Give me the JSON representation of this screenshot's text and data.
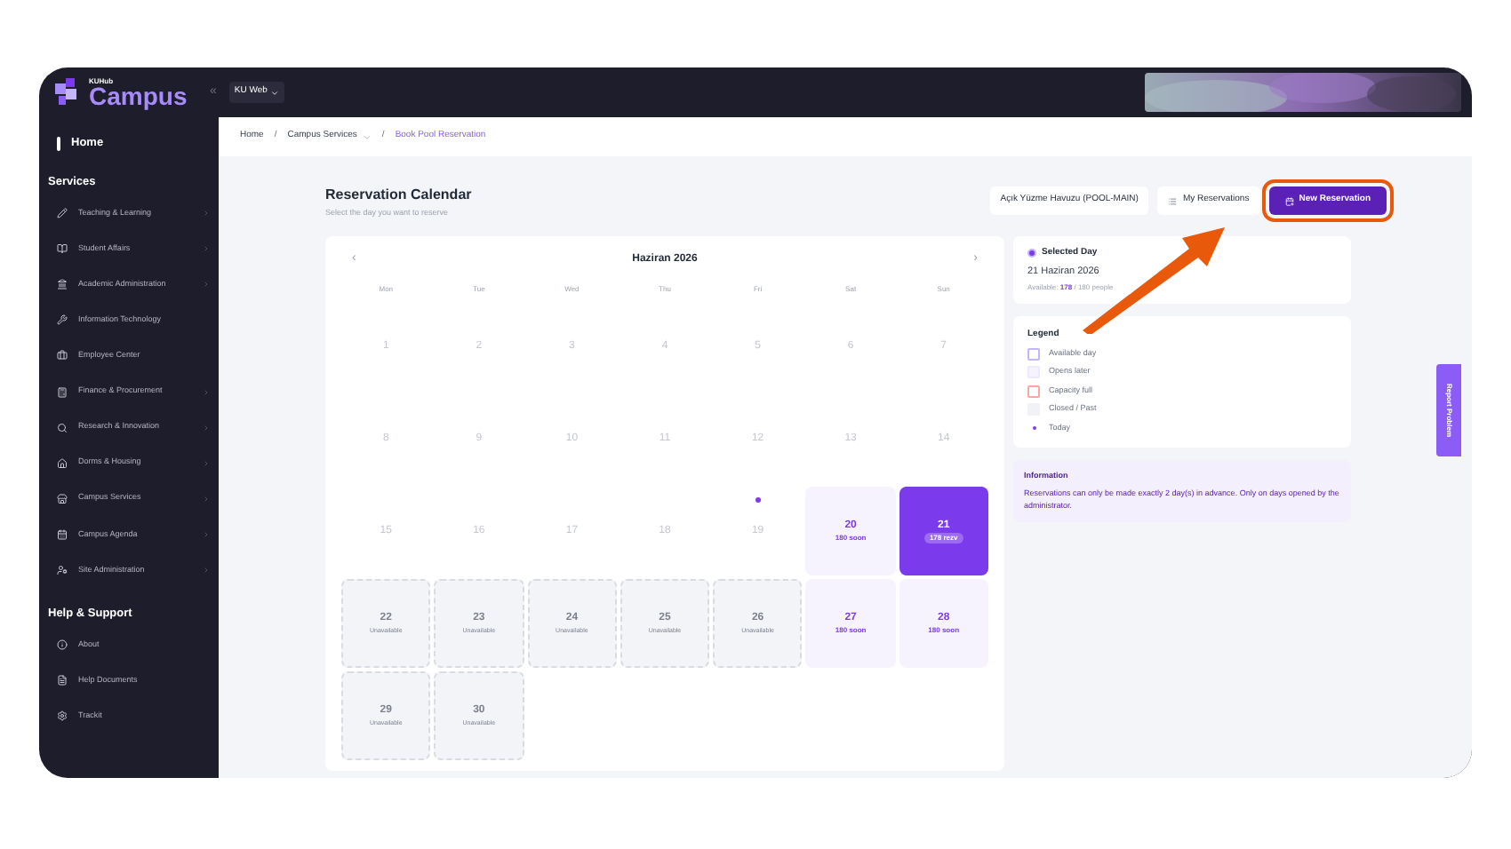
{
  "topbar": {
    "logo_small": "KUHub",
    "logo": "Campus",
    "collapse": "«",
    "site_selector": "KU Web"
  },
  "sidebar": {
    "home": "Home",
    "sections": [
      {
        "title": "Services",
        "items": [
          {
            "label": "Teaching & Learning",
            "has_submenu": true
          },
          {
            "label": "Student Affairs",
            "has_submenu": true
          },
          {
            "label": "Academic Administration",
            "has_submenu": true
          },
          {
            "label": "Information Technology",
            "has_submenu": false
          },
          {
            "label": "Employee Center",
            "has_submenu": false
          },
          {
            "label": "Finance & Procurement",
            "has_submenu": true
          },
          {
            "label": "Research & Innovation",
            "has_submenu": true
          },
          {
            "label": "Dorms & Housing",
            "has_submenu": true
          },
          {
            "label": "Campus Services",
            "has_submenu": true
          },
          {
            "label": "Campus Agenda",
            "has_submenu": true
          },
          {
            "label": "Site Administration",
            "has_submenu": true
          }
        ]
      },
      {
        "title": "Help & Support",
        "items": [
          {
            "label": "About",
            "has_submenu": false
          },
          {
            "label": "Help Documents",
            "has_submenu": false
          },
          {
            "label": "Trackit",
            "has_submenu": false
          }
        ]
      }
    ]
  },
  "breadcrumb": [
    {
      "kind": "link",
      "label": "Home",
      "current": false,
      "dropdown": false
    },
    {
      "kind": "separator",
      "label": "/"
    },
    {
      "kind": "link",
      "label": "Campus Services",
      "current": false,
      "dropdown": true
    },
    {
      "kind": "separator",
      "label": "/"
    },
    {
      "kind": "link",
      "label": "Book Pool Reservation",
      "current": true,
      "dropdown": false
    }
  ],
  "header": {
    "title": "Reservation Calendar",
    "subtitle": "Select the day you want to reserve",
    "pool": "Açık Yüzme Havuzu (POOL-MAIN)",
    "my_reservations": "My Reservations",
    "new_reservation": "New Reservation"
  },
  "calendar": {
    "prev": "‹",
    "month": "Haziran 2026",
    "next": "›",
    "weekdays": [
      "Mon",
      "Tue",
      "Wed",
      "Thu",
      "Fri",
      "Sat",
      "Sun"
    ],
    "days": [
      {
        "day": "1",
        "kind": "past",
        "selected": false,
        "today": false
      },
      {
        "day": "2",
        "kind": "past",
        "selected": false,
        "today": false
      },
      {
        "day": "3",
        "kind": "past",
        "selected": false,
        "today": false
      },
      {
        "day": "4",
        "kind": "past",
        "selected": false,
        "today": false
      },
      {
        "day": "5",
        "kind": "past",
        "selected": false,
        "today": false
      },
      {
        "day": "6",
        "kind": "past",
        "selected": false,
        "today": false
      },
      {
        "day": "7",
        "kind": "past",
        "selected": false,
        "today": false
      },
      {
        "day": "8",
        "kind": "past",
        "selected": false,
        "today": false
      },
      {
        "day": "9",
        "kind": "past",
        "selected": false,
        "today": false
      },
      {
        "day": "10",
        "kind": "past",
        "selected": false,
        "today": false
      },
      {
        "day": "11",
        "kind": "past",
        "selected": false,
        "today": false
      },
      {
        "day": "12",
        "kind": "past",
        "selected": false,
        "today": false
      },
      {
        "day": "13",
        "kind": "past",
        "selected": false,
        "today": false
      },
      {
        "day": "14",
        "kind": "past",
        "selected": false,
        "today": false
      },
      {
        "day": "15",
        "kind": "past",
        "selected": false,
        "today": false
      },
      {
        "day": "16",
        "kind": "past",
        "selected": false,
        "today": false
      },
      {
        "day": "17",
        "kind": "past",
        "selected": false,
        "today": false
      },
      {
        "day": "18",
        "kind": "past",
        "selected": false,
        "today": false
      },
      {
        "day": "19",
        "kind": "past",
        "selected": false,
        "today": true
      },
      {
        "day": "20",
        "kind": "available",
        "note": "180 soon",
        "selected": false,
        "today": false
      },
      {
        "day": "21",
        "kind": "available",
        "note": "178 rezv",
        "selected": true,
        "today": false
      },
      {
        "day": "22",
        "kind": "unavailable",
        "note": "Unavailable",
        "selected": false,
        "today": false
      },
      {
        "day": "23",
        "kind": "unavailable",
        "note": "Unavailable",
        "selected": false,
        "today": false
      },
      {
        "day": "24",
        "kind": "unavailable",
        "note": "Unavailable",
        "selected": false,
        "today": false
      },
      {
        "day": "25",
        "kind": "unavailable",
        "note": "Unavailable",
        "selected": false,
        "today": false
      },
      {
        "day": "26",
        "kind": "unavailable",
        "note": "Unavailable",
        "selected": false,
        "today": false
      },
      {
        "day": "27",
        "kind": "available",
        "note": "180 soon",
        "selected": false,
        "today": false
      },
      {
        "day": "28",
        "kind": "available",
        "note": "180 soon",
        "selected": false,
        "today": false
      },
      {
        "day": "29",
        "kind": "unavailable",
        "note": "Unavailable",
        "selected": false,
        "today": false
      },
      {
        "day": "30",
        "kind": "unavailable",
        "note": "Unavailable",
        "selected": false,
        "today": false
      }
    ]
  },
  "selected_day": {
    "title": "Selected Day",
    "date": "21 Haziran 2026",
    "available_label": "Available:",
    "available": "178",
    "capacity": "/ 180 people"
  },
  "legend": {
    "title": "Legend",
    "items": [
      {
        "label": "Available day",
        "kind": "available"
      },
      {
        "label": "Opens later",
        "kind": "opens_later"
      },
      {
        "label": "Capacity full",
        "kind": "full"
      },
      {
        "label": "Closed / Past",
        "kind": "closed"
      },
      {
        "label": "Today",
        "kind": "today"
      }
    ]
  },
  "information": {
    "title": "Information",
    "text": "Reservations can only be made exactly 2 day(s) in advance. Only on days opened by the administrator."
  },
  "report_problem": "Report Problem"
}
